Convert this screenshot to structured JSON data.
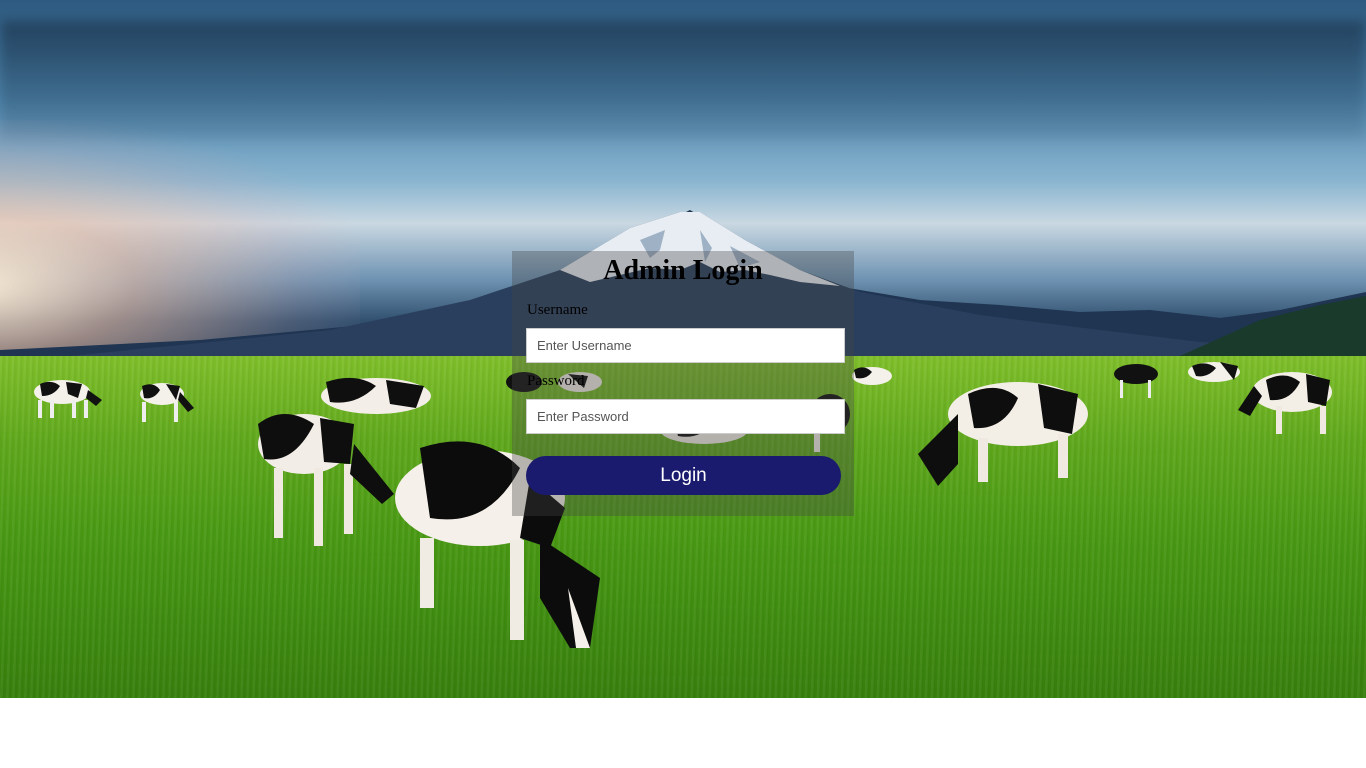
{
  "page": {
    "background_image": "mountain-meadow-with-grazing-cows",
    "accent_color": "#1a1a6e"
  },
  "login": {
    "title": "Admin Login",
    "username_label": "Username",
    "username_placeholder": "Enter Username",
    "username_value": "",
    "password_label": "Password",
    "password_placeholder": "Enter Password",
    "password_value": "",
    "button_label": "Login"
  }
}
